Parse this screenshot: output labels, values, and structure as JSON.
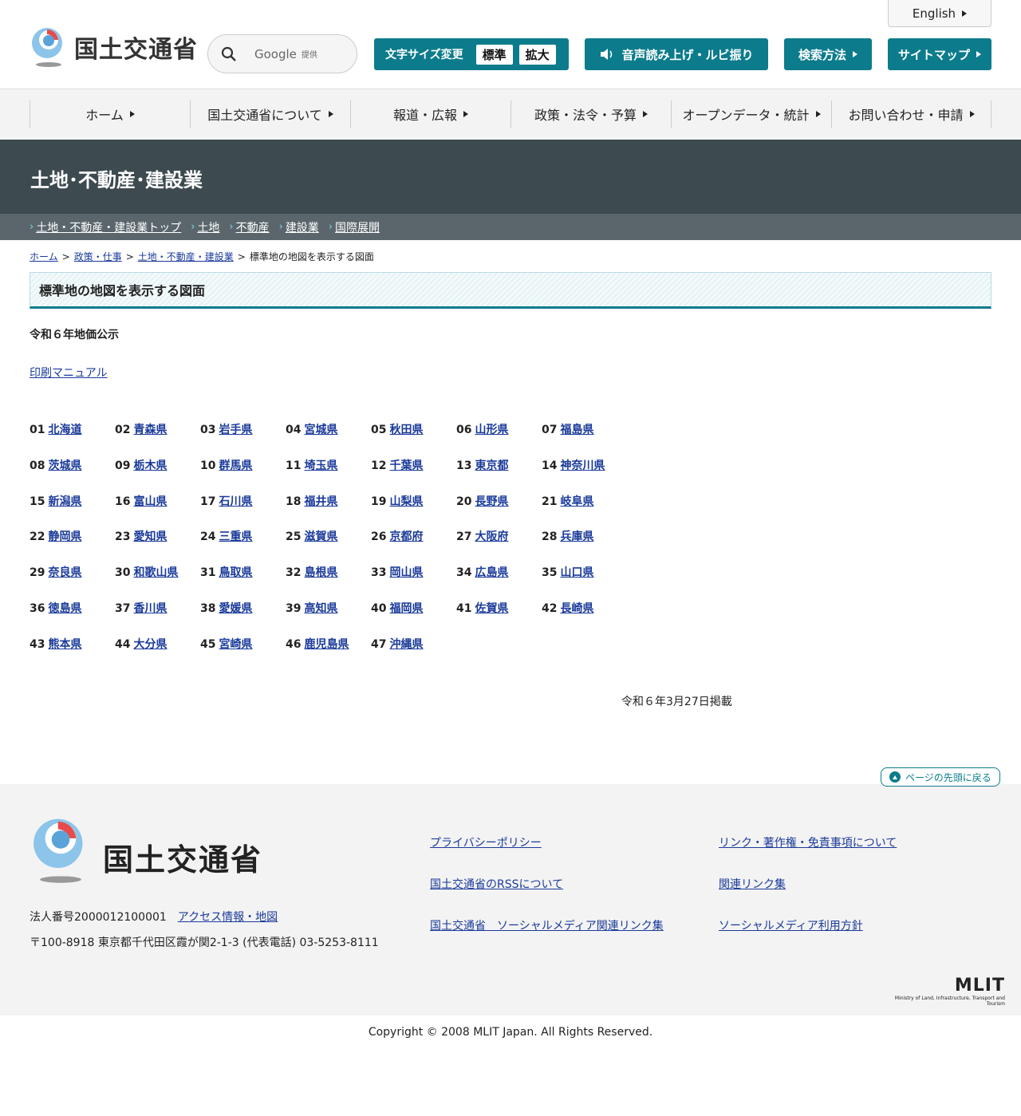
{
  "header": {
    "logo_text": "国土交通省",
    "search": {
      "google": "Google",
      "teikyo": "提供"
    },
    "english": "English",
    "font_size": {
      "label": "文字サイズ変更",
      "normal": "標準",
      "large": "拡大"
    },
    "voice": "音声読み上げ・ルビ振り",
    "howto": "検索方法",
    "sitemap": "サイトマップ"
  },
  "gnav": [
    "ホーム",
    "国土交通省について",
    "報道・広報",
    "政策・法令・予算",
    "オープンデータ・統計",
    "お問い合わせ・申請"
  ],
  "category": {
    "title": "土地･不動産･建設業",
    "subnav": [
      "土地・不動産・建設業トップ",
      "土地",
      "不動産",
      "建設業",
      "国際展開"
    ]
  },
  "breadcrumb": {
    "links": [
      "ホーム",
      "政策・仕事",
      "土地・不動産・建設業"
    ],
    "current": "標準地の地図を表示する図面"
  },
  "page_title": "標準地の地図を表示する図面",
  "subtitle": "令和６年地価公示",
  "manual_link": "印刷マニュアル",
  "prefectures": [
    {
      "num": "01",
      "name": "北海道"
    },
    {
      "num": "02",
      "name": "青森県"
    },
    {
      "num": "03",
      "name": "岩手県"
    },
    {
      "num": "04",
      "name": "宮城県"
    },
    {
      "num": "05",
      "name": "秋田県"
    },
    {
      "num": "06",
      "name": "山形県"
    },
    {
      "num": "07",
      "name": "福島県"
    },
    {
      "num": "08",
      "name": "茨城県"
    },
    {
      "num": "09",
      "name": "栃木県"
    },
    {
      "num": "10",
      "name": "群馬県"
    },
    {
      "num": "11",
      "name": "埼玉県"
    },
    {
      "num": "12",
      "name": "千葉県"
    },
    {
      "num": "13",
      "name": "東京都"
    },
    {
      "num": "14",
      "name": "神奈川県"
    },
    {
      "num": "15",
      "name": "新潟県"
    },
    {
      "num": "16",
      "name": "富山県"
    },
    {
      "num": "17",
      "name": "石川県"
    },
    {
      "num": "18",
      "name": "福井県"
    },
    {
      "num": "19",
      "name": "山梨県"
    },
    {
      "num": "20",
      "name": "長野県"
    },
    {
      "num": "21",
      "name": "岐阜県"
    },
    {
      "num": "22",
      "name": "静岡県"
    },
    {
      "num": "23",
      "name": "愛知県"
    },
    {
      "num": "24",
      "name": "三重県"
    },
    {
      "num": "25",
      "name": "滋賀県"
    },
    {
      "num": "26",
      "name": "京都府"
    },
    {
      "num": "27",
      "name": "大阪府"
    },
    {
      "num": "28",
      "name": "兵庫県"
    },
    {
      "num": "29",
      "name": "奈良県"
    },
    {
      "num": "30",
      "name": "和歌山県"
    },
    {
      "num": "31",
      "name": "鳥取県"
    },
    {
      "num": "32",
      "name": "島根県"
    },
    {
      "num": "33",
      "name": "岡山県"
    },
    {
      "num": "34",
      "name": "広島県"
    },
    {
      "num": "35",
      "name": "山口県"
    },
    {
      "num": "36",
      "name": "徳島県"
    },
    {
      "num": "37",
      "name": "香川県"
    },
    {
      "num": "38",
      "name": "愛媛県"
    },
    {
      "num": "39",
      "name": "高知県"
    },
    {
      "num": "40",
      "name": "福岡県"
    },
    {
      "num": "41",
      "name": "佐賀県"
    },
    {
      "num": "42",
      "name": "長崎県"
    },
    {
      "num": "43",
      "name": "熊本県"
    },
    {
      "num": "44",
      "name": "大分県"
    },
    {
      "num": "45",
      "name": "宮崎県"
    },
    {
      "num": "46",
      "name": "鹿児島県"
    },
    {
      "num": "47",
      "name": "沖縄県"
    }
  ],
  "posted_date": "令和６年3月27日掲載",
  "page_top": "ページの先頭に戻る",
  "footer": {
    "logo_text": "国土交通省",
    "corp_number": "法人番号2000012100001",
    "access_link": "アクセス情報・地図",
    "address": "〒100-8918 東京都千代田区霞が関2-1-3 (代表電話) 03-5253-8111",
    "links_col1": [
      "プライバシーポリシー",
      "国土交通省のRSSについて",
      "国土交通省　ソーシャルメディア関連リンク集"
    ],
    "links_col2": [
      "リンク・著作権・免責事項について",
      "関連リンク集",
      "ソーシャルメディア利用方針"
    ],
    "mlit_logo": "MLIT",
    "mlit_sub": "Ministry of Land, Infrastructure, Transport and Tourism"
  },
  "copyright": "Copyright © 2008 MLIT Japan. All Rights Reserved.",
  "colors": {
    "accent": "#0c7c8c",
    "banner": "#3d4a50",
    "subnav": "#5a666c",
    "link": "#1a3a9a"
  }
}
